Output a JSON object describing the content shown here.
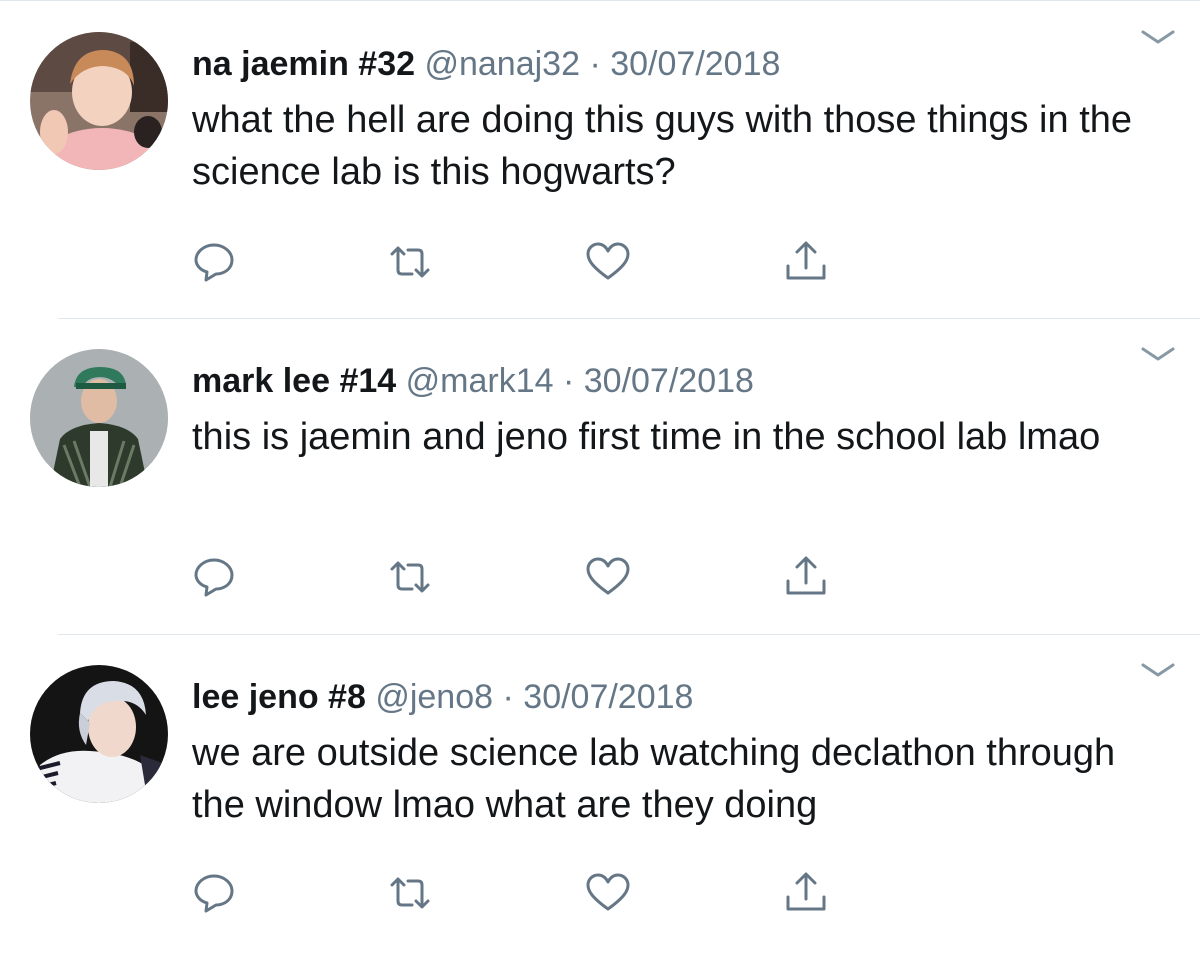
{
  "tweets": [
    {
      "display_name": "na jaemin #32",
      "handle": "@nanaj32",
      "separator": "·",
      "date": "30/07/2018",
      "text": "what the hell are doing this guys with those things in the science lab is this hogwarts?"
    },
    {
      "display_name": "mark lee #14",
      "handle": "@mark14",
      "separator": "·",
      "date": "30/07/2018",
      "text": "this is jaemin and jeno first time in the school lab lmao"
    },
    {
      "display_name": "lee jeno #8",
      "handle": "@jeno8",
      "separator": "·",
      "date": "30/07/2018",
      "text": "we are outside science lab watching declathon through the window lmao what are they doing"
    }
  ],
  "icons": {
    "reply": "reply-icon",
    "retweet": "retweet-icon",
    "like": "heart-icon",
    "share": "share-icon",
    "more": "chevron-down-icon"
  },
  "colors": {
    "text": "#14171a",
    "secondary": "#657786",
    "divider": "#e1e8ed",
    "icon": "#657786"
  }
}
